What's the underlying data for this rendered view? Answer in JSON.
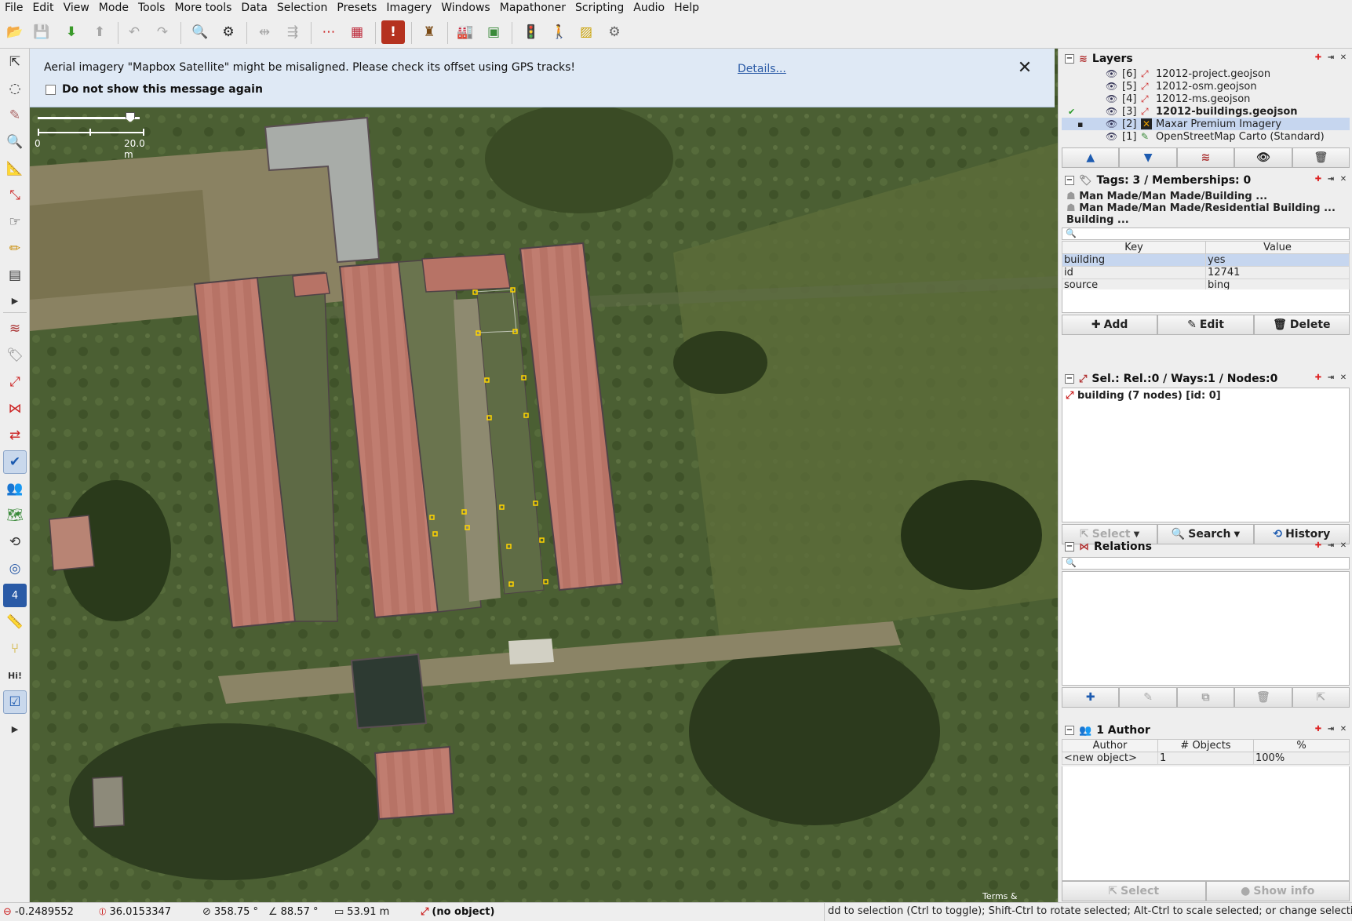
{
  "menu": [
    "File",
    "Edit",
    "View",
    "Mode",
    "Tools",
    "More tools",
    "Data",
    "Selection",
    "Presets",
    "Imagery",
    "Windows",
    "Mapathoner",
    "Scripting",
    "Audio",
    "Help"
  ],
  "notice": {
    "message": "Aerial imagery \"Mapbox Satellite\" might be misaligned. Please check its offset using GPS tracks!",
    "details_link": "Details...",
    "checkbox_label": "Do not show this message again",
    "close": "✕"
  },
  "scale": {
    "zero": "0",
    "end": "20.0 m"
  },
  "map": {
    "terms": "Terms & Feedback"
  },
  "layers": {
    "title": "Layers",
    "items": [
      {
        "num": "[6]",
        "name": "12012-project.geojson"
      },
      {
        "num": "[5]",
        "name": "12012-osm.geojson"
      },
      {
        "num": "[4]",
        "name": "12012-ms.geojson"
      },
      {
        "num": "[3]",
        "name": "12012-buildings.geojson"
      },
      {
        "num": "[2]",
        "name": "Maxar Premium Imagery"
      },
      {
        "num": "[1]",
        "name": "OpenStreetMap Carto (Standard)"
      }
    ]
  },
  "tags": {
    "title": "Tags: 3 / Memberships: 0",
    "presets": [
      "Man Made/Man Made/Building ...",
      "Man Made/Man Made/Residential Building ...",
      "Building  ..."
    ],
    "columns": [
      "Key",
      "Value"
    ],
    "rows": [
      {
        "key": "building",
        "value": "yes"
      },
      {
        "key": "id",
        "value": "12741"
      },
      {
        "key": "source",
        "value": "bing"
      }
    ],
    "buttons": {
      "add": "Add",
      "edit": "Edit",
      "delete": "Delete"
    }
  },
  "selection": {
    "title": "Sel.: Rel.:0 / Ways:1 / Nodes:0",
    "items": [
      "building (7 nodes) [id: 0]"
    ],
    "buttons": {
      "select": "Select",
      "search": "Search",
      "history": "History"
    }
  },
  "relations": {
    "title": "Relations"
  },
  "authors": {
    "title": "1 Author",
    "columns": [
      "Author",
      "# Objects",
      "%"
    ],
    "rows": [
      {
        "author": "<new object>",
        "objects": "1",
        "percent": "100%"
      }
    ],
    "buttons": {
      "select": "Select",
      "show_info": "Show info"
    }
  },
  "status": {
    "lat": "-0.2489552",
    "lon": "36.0153347",
    "heading": "358.75 °",
    "angle": "88.57 °",
    "distance": "53.91 m",
    "object": "(no object)",
    "help": "dd to selection (Ctrl to toggle); Shift-Ctrl to rotate selected; Alt-Ctrl to scale selected; or change selection"
  },
  "colors": {
    "accent": "#2a5aa6",
    "selection": "#c6d6ef",
    "notice_bg": "#dfe9f5"
  }
}
